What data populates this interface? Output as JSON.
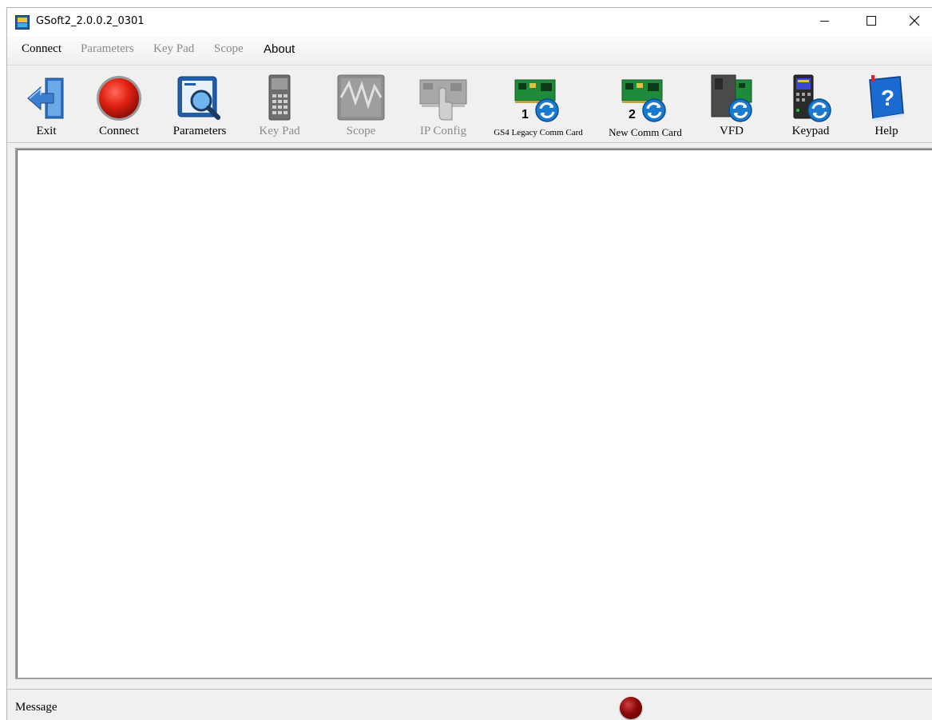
{
  "window": {
    "title": "GSoft2_2.0.0.2_0301"
  },
  "menu": {
    "items": [
      {
        "label": "Connect",
        "enabled": true
      },
      {
        "label": "Parameters",
        "enabled": false
      },
      {
        "label": "Key Pad",
        "enabled": false
      },
      {
        "label": "Scope",
        "enabled": false
      },
      {
        "label": "About",
        "enabled": true
      }
    ]
  },
  "toolbar": {
    "items": [
      {
        "label": "Exit",
        "icon": "exit-door-icon",
        "enabled": true
      },
      {
        "label": "Connect",
        "icon": "red-connect-icon",
        "enabled": true
      },
      {
        "label": "Parameters",
        "icon": "parameters-magnifier-icon",
        "enabled": true
      },
      {
        "label": "Key Pad",
        "icon": "keypad-device-icon",
        "enabled": false
      },
      {
        "label": "Scope",
        "icon": "scope-waveform-icon",
        "enabled": false
      },
      {
        "label": "IP Config",
        "icon": "ip-config-card-icon",
        "enabled": false
      },
      {
        "label": "GS4 Legacy Comm Card",
        "icon": "legacy-comm-card-update-icon",
        "enabled": true,
        "badge": "1"
      },
      {
        "label": "New Comm Card",
        "icon": "new-comm-card-update-icon",
        "enabled": true,
        "badge": "2"
      },
      {
        "label": "VFD",
        "icon": "vfd-update-icon",
        "enabled": true
      },
      {
        "label": "Keypad",
        "icon": "keypad-update-icon",
        "enabled": true
      },
      {
        "label": "Help",
        "icon": "help-book-icon",
        "enabled": true
      }
    ]
  },
  "status": {
    "message": "Message",
    "led_color": "#8a0808"
  }
}
